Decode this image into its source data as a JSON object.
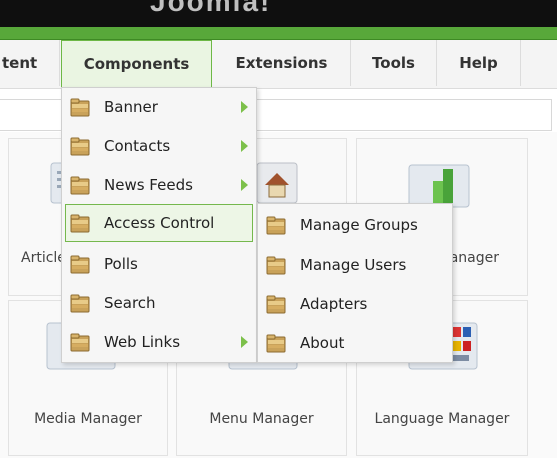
{
  "header": {
    "title": "Joomla!"
  },
  "menubar": {
    "items": [
      {
        "label": "tent"
      },
      {
        "label": "Components"
      },
      {
        "label": "Extensions"
      },
      {
        "label": "Tools"
      },
      {
        "label": "Help"
      }
    ]
  },
  "cpanel": {
    "tiles": [
      {
        "label": "Article"
      },
      {
        "label": "Manager"
      },
      {
        "label": "Media Manager"
      },
      {
        "label": "Menu Manager"
      },
      {
        "label": "Language Manager"
      }
    ]
  },
  "components_menu": {
    "items": [
      {
        "label": "Banner",
        "has_submenu": true
      },
      {
        "label": "Contacts",
        "has_submenu": true
      },
      {
        "label": "News Feeds",
        "has_submenu": true
      },
      {
        "label": "Access Control",
        "has_submenu": true,
        "highlighted": true
      },
      {
        "label": "Polls",
        "has_submenu": false
      },
      {
        "label": "Search",
        "has_submenu": false
      },
      {
        "label": "Web Links",
        "has_submenu": true
      }
    ]
  },
  "access_control_submenu": {
    "items": [
      {
        "label": "Manage Groups"
      },
      {
        "label": "Manage Users"
      },
      {
        "label": "Adapters"
      },
      {
        "label": "About"
      }
    ]
  },
  "colors": {
    "accent_green": "#58a83a",
    "highlight_border": "#75b84d",
    "arrow_green": "#7cc04a",
    "folder_icon": "#c9a25a"
  }
}
